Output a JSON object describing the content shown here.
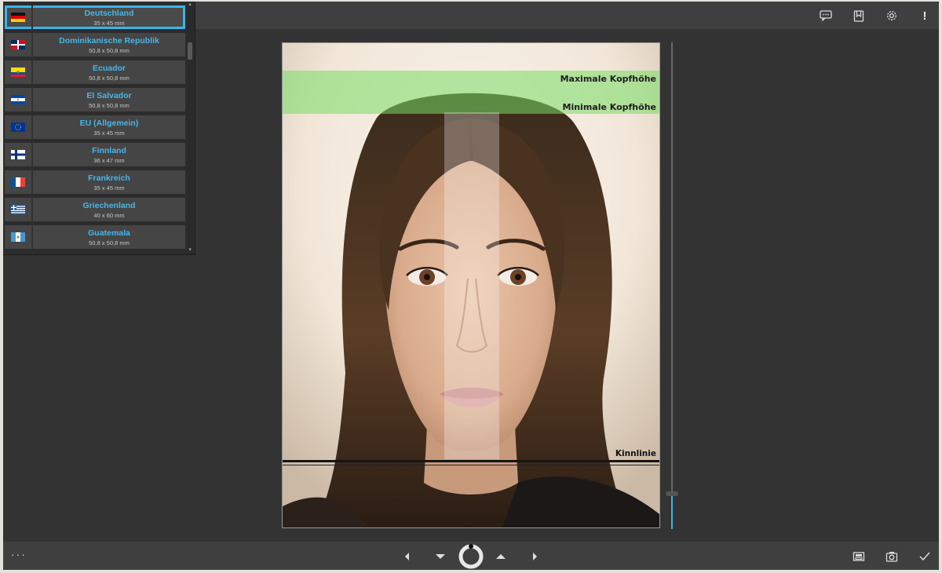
{
  "toolbar": {
    "top_icons": [
      "comment-icon",
      "bookmark-icon",
      "settings-icon",
      "alert-icon"
    ],
    "alert_glyph": "!"
  },
  "country_list": {
    "items": [
      {
        "name": "Deutschland",
        "size": "35 x 45 mm",
        "flag": "de",
        "selected": true
      },
      {
        "name": "Dominikanische Republik",
        "size": "50,8 x 50,8 mm",
        "flag": "do"
      },
      {
        "name": "Ecuador",
        "size": "50,8 x 50,8 mm",
        "flag": "ec"
      },
      {
        "name": "El Salvador",
        "size": "50,8 x 50,8 mm",
        "flag": "sv"
      },
      {
        "name": "EU (Allgemein)",
        "size": "35 x 45 mm",
        "flag": "eu"
      },
      {
        "name": "Finnland",
        "size": "36 x 47 mm",
        "flag": "fi"
      },
      {
        "name": "Frankreich",
        "size": "35 x 45 mm",
        "flag": "fr"
      },
      {
        "name": "Griechenland",
        "size": "40 x 60 mm",
        "flag": "gr"
      },
      {
        "name": "Guatemala",
        "size": "50,8 x 50,8 mm",
        "flag": "gt"
      }
    ]
  },
  "photo": {
    "max_head_label": "Maximale Kopfhöhe",
    "min_head_label": "Minimale Kopfhöhe",
    "chin_label": "Kinnlinie"
  },
  "bottom_bar": {
    "more_label": "···",
    "nav_icons": [
      "arrow-left-icon",
      "arrow-down-icon",
      "rotate-dial-icon",
      "arrow-up-icon",
      "arrow-right-icon"
    ],
    "right_icons": [
      "save-icon",
      "camera-icon",
      "check-icon"
    ]
  },
  "colors": {
    "accent": "#3ab4ea",
    "guide_band": "#78dc64",
    "background": "#333333"
  }
}
